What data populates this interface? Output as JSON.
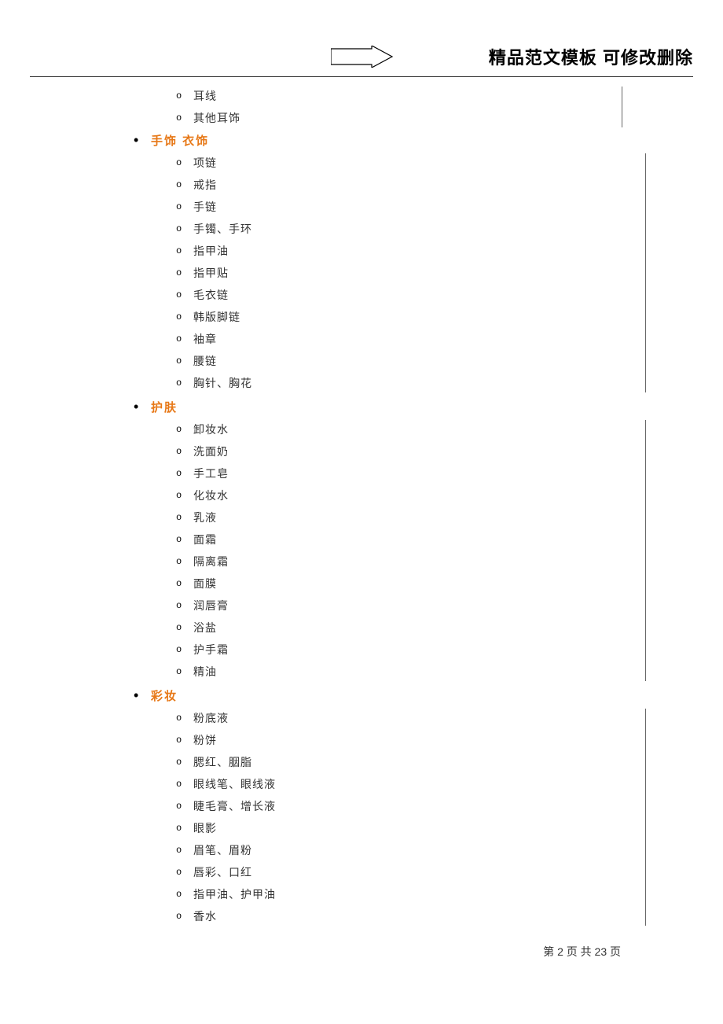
{
  "header": {
    "title": "精品范文模板  可修改删除"
  },
  "orphan_items": [
    "耳线",
    "其他耳饰"
  ],
  "categories": [
    {
      "label": "手饰  衣饰",
      "items": [
        "项链",
        "戒指",
        "手链",
        "手镯、手环",
        "指甲油",
        "指甲贴",
        "毛衣链",
        "韩版脚链",
        "袖章",
        "腰链",
        "胸针、胸花"
      ]
    },
    {
      "label": "护肤",
      "items": [
        "卸妆水",
        "洗面奶",
        "手工皂",
        "化妆水",
        "乳液",
        "面霜",
        "隔离霜",
        "面膜",
        "润唇膏",
        "浴盐",
        "护手霜",
        "精油"
      ]
    },
    {
      "label": "彩妆",
      "items": [
        "粉底液",
        "粉饼",
        "腮红、胭脂",
        "眼线笔、眼线液",
        "睫毛膏、增长液",
        "眼影",
        "眉笔、眉粉",
        "唇彩、口红",
        "指甲油、护甲油",
        "香水"
      ]
    }
  ],
  "pagination": {
    "prefix": "第",
    "current": "2",
    "mid": "页 共",
    "total": "23",
    "suffix": "页"
  }
}
